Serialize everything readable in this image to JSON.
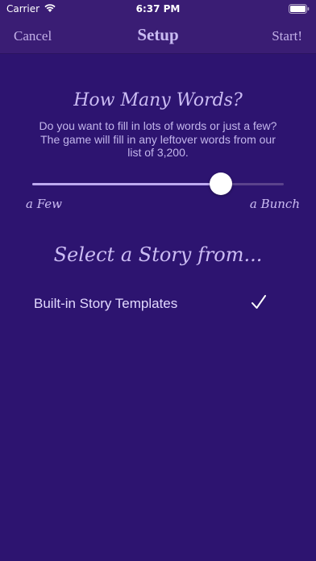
{
  "status_bar": {
    "carrier": "Carrier",
    "time": "6:37 PM",
    "icons": [
      "wifi-icon",
      "battery-icon"
    ]
  },
  "nav": {
    "cancel_label": "Cancel",
    "title": "Setup",
    "start_label": "Start!"
  },
  "words_section": {
    "title": "How Many Words?",
    "description": "Do you want to fill in lots of words or just a few? The game will fill in any leftover words from our list of 3,200.",
    "slider": {
      "value_fraction": 0.75,
      "min_label": "a Few",
      "max_label": "a Bunch"
    }
  },
  "story_section": {
    "title": "Select a Story from...",
    "options": [
      {
        "label": "Built-in Story Templates",
        "selected": true,
        "icon": "checkmark-icon"
      }
    ]
  },
  "colors": {
    "background": "#2d1470",
    "nav_background": "#3a1d74",
    "accent_text": "#cbbcf3",
    "slider_fill": "#bda9f0",
    "slider_track": "#5b438c"
  }
}
